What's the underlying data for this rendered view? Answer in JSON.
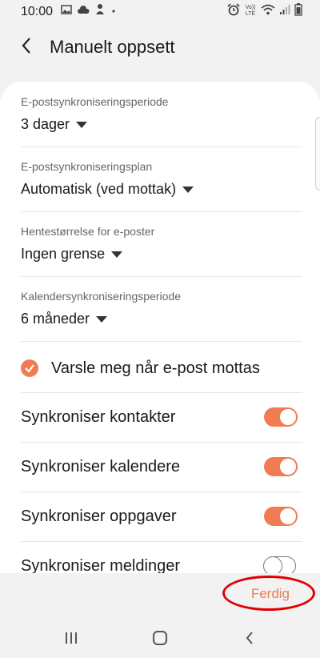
{
  "status_bar": {
    "time": "10:00",
    "left_icons": [
      "image-icon",
      "cloud-icon",
      "notification-icon",
      "dot-icon"
    ],
    "right_icons": [
      "alarm-icon",
      "volte-icon",
      "wifi-icon",
      "signal-icon",
      "battery-icon"
    ],
    "volte_label": "Vo)) LTE"
  },
  "header": {
    "title": "Manuelt oppsett"
  },
  "settings": {
    "email_sync_period": {
      "label": "E-postsynkroniseringsperiode",
      "value": "3 dager"
    },
    "email_sync_schedule": {
      "label": "E-postsynkroniseringsplan",
      "value": "Automatisk (ved mottak)"
    },
    "retrieve_size": {
      "label": "Hentestørrelse for e-poster",
      "value": "Ingen grense"
    },
    "calendar_sync_period": {
      "label": "Kalendersynkroniseringsperiode",
      "value": "6 måneder"
    },
    "notify": {
      "label": "Varsle meg når e-post mottas",
      "checked": true
    },
    "toggles": [
      {
        "label": "Synkroniser kontakter",
        "on": true
      },
      {
        "label": "Synkroniser kalendere",
        "on": true
      },
      {
        "label": "Synkroniser oppgaver",
        "on": true
      },
      {
        "label": "Synkroniser meldinger",
        "on": false
      }
    ]
  },
  "footer": {
    "done_label": "Ferdig"
  },
  "colors": {
    "accent": "#f07c52",
    "highlight": "#e00000"
  }
}
